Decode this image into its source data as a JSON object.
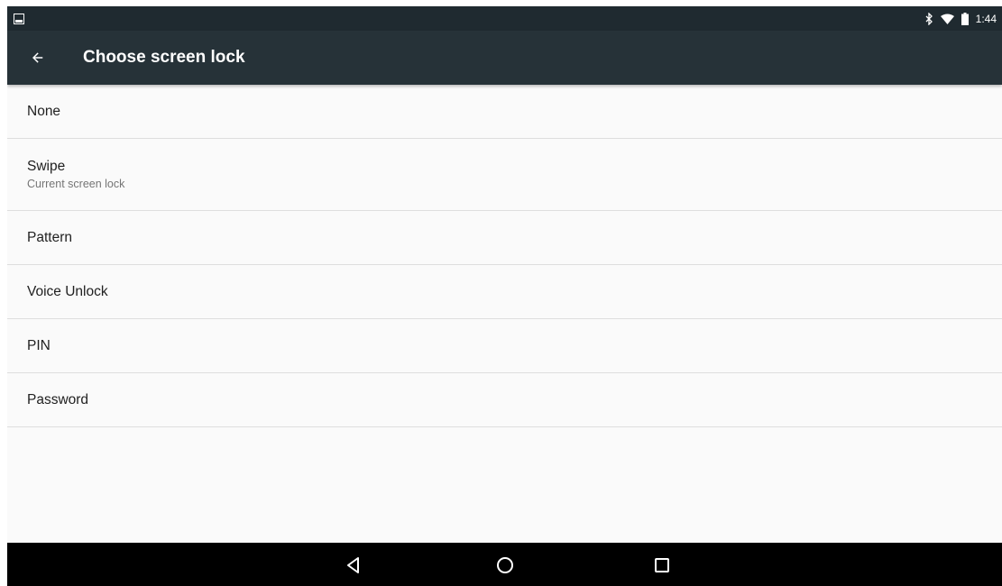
{
  "status_bar": {
    "time": "1:44",
    "icons": [
      "gallery-icon",
      "bluetooth-icon",
      "wifi-icon",
      "battery-icon"
    ]
  },
  "app_bar": {
    "back_icon": "arrow-back-icon",
    "title": "Choose screen lock"
  },
  "options": [
    {
      "title": "None",
      "summary": ""
    },
    {
      "title": "Swipe",
      "summary": "Current screen lock"
    },
    {
      "title": "Pattern",
      "summary": ""
    },
    {
      "title": "Voice Unlock",
      "summary": ""
    },
    {
      "title": "PIN",
      "summary": ""
    },
    {
      "title": "Password",
      "summary": ""
    }
  ],
  "nav_bar": {
    "icons": [
      "back-triangle-icon",
      "home-circle-icon",
      "recents-square-icon"
    ]
  },
  "colors": {
    "status_bar": "#1f2a30",
    "app_bar": "#263238",
    "background": "#fafafa",
    "divider": "#dedede",
    "nav_bar": "#000000"
  }
}
